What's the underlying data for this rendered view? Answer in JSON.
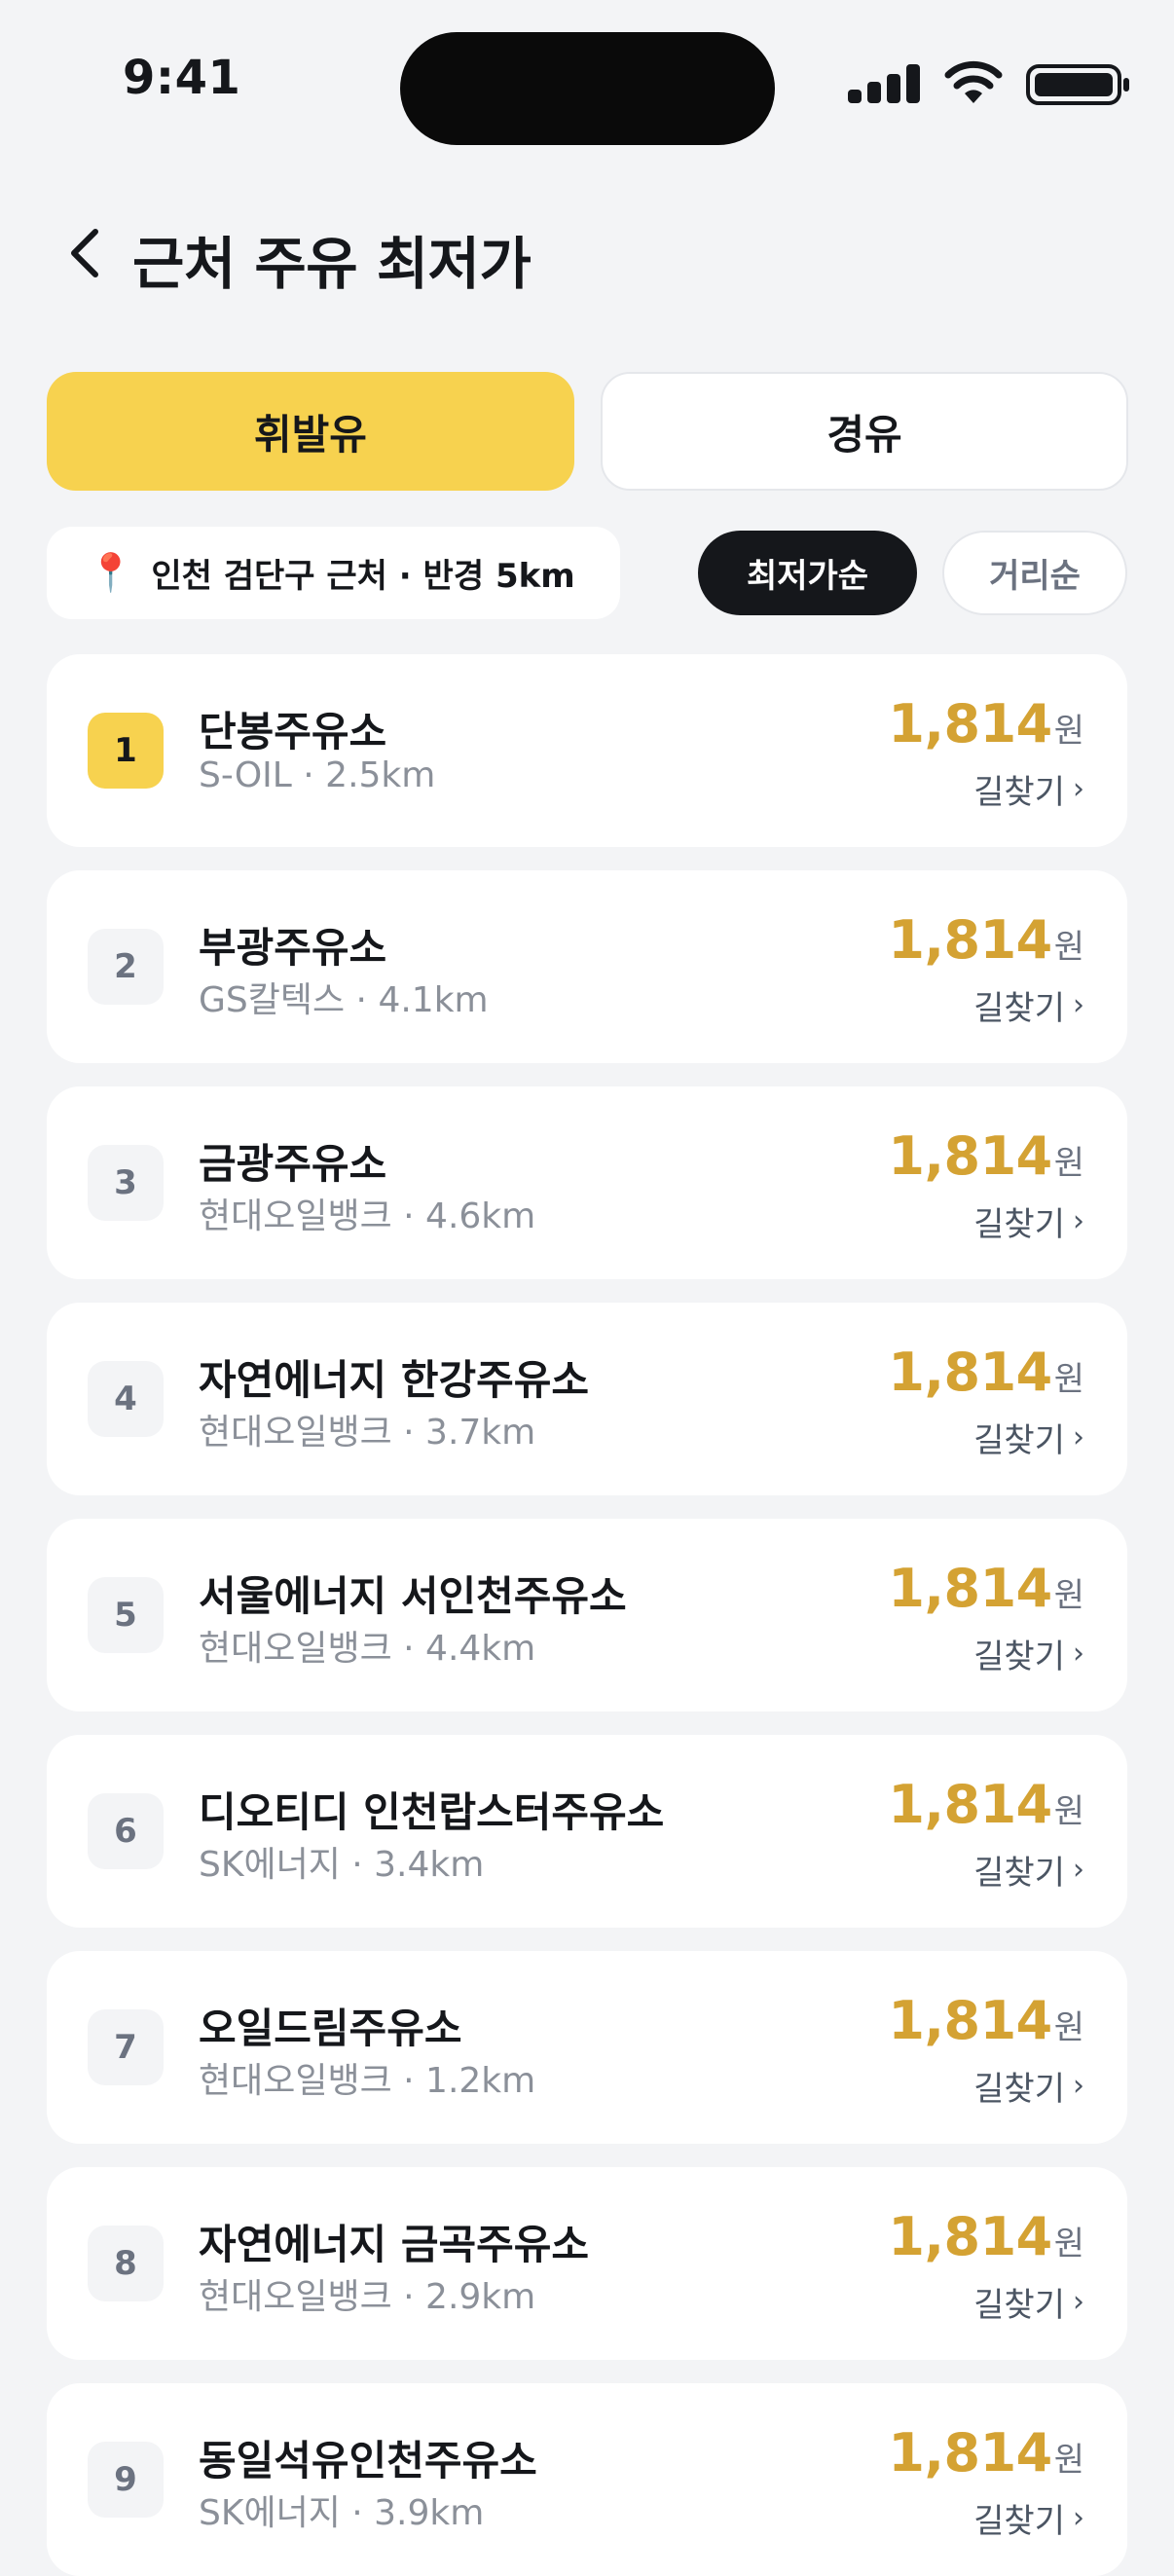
{
  "status_bar": {
    "time": "9:41"
  },
  "header": {
    "title": "근처 주유 최저가"
  },
  "fuel_tabs": [
    {
      "label": "휘발유",
      "active": true
    },
    {
      "label": "경유",
      "active": false
    }
  ],
  "location": {
    "icon": "pin-icon",
    "text": "인천 검단구 근처 · 반경 5km"
  },
  "sort": [
    {
      "label": "최저가순",
      "active": true
    },
    {
      "label": "거리순",
      "active": false
    }
  ],
  "stations": [
    {
      "rank": "1",
      "name": "단봉주유소",
      "meta": "S-OIL · 2.5km",
      "price": "1,814",
      "unit": "원",
      "action": "길찾기"
    },
    {
      "rank": "2",
      "name": "부광주유소",
      "meta": "GS칼텍스 · 4.1km",
      "price": "1,814",
      "unit": "원",
      "action": "길찾기"
    },
    {
      "rank": "3",
      "name": "금광주유소",
      "meta": "현대오일뱅크 · 4.6km",
      "price": "1,814",
      "unit": "원",
      "action": "길찾기"
    },
    {
      "rank": "4",
      "name": "자연에너지 한강주유소",
      "meta": "현대오일뱅크 · 3.7km",
      "price": "1,814",
      "unit": "원",
      "action": "길찾기"
    },
    {
      "rank": "5",
      "name": "서울에너지 서인천주유소",
      "meta": "현대오일뱅크 · 4.4km",
      "price": "1,814",
      "unit": "원",
      "action": "길찾기"
    },
    {
      "rank": "6",
      "name": "디오티디 인천랍스터주유소",
      "meta": "SK에너지 · 3.4km",
      "price": "1,814",
      "unit": "원",
      "action": "길찾기"
    },
    {
      "rank": "7",
      "name": "오일드림주유소",
      "meta": "현대오일뱅크 · 1.2km",
      "price": "1,814",
      "unit": "원",
      "action": "길찾기"
    },
    {
      "rank": "8",
      "name": "자연에너지 금곡주유소",
      "meta": "현대오일뱅크 · 2.9km",
      "price": "1,814",
      "unit": "원",
      "action": "길찾기"
    },
    {
      "rank": "9",
      "name": "동일석유인천주유소",
      "meta": "SK에너지 · 3.9km",
      "price": "1,814",
      "unit": "원",
      "action": "길찾기"
    }
  ],
  "colors": {
    "accent": "#f7d24f",
    "price": "#d4a233",
    "dark": "#15171b",
    "background": "#f3f4f6"
  }
}
